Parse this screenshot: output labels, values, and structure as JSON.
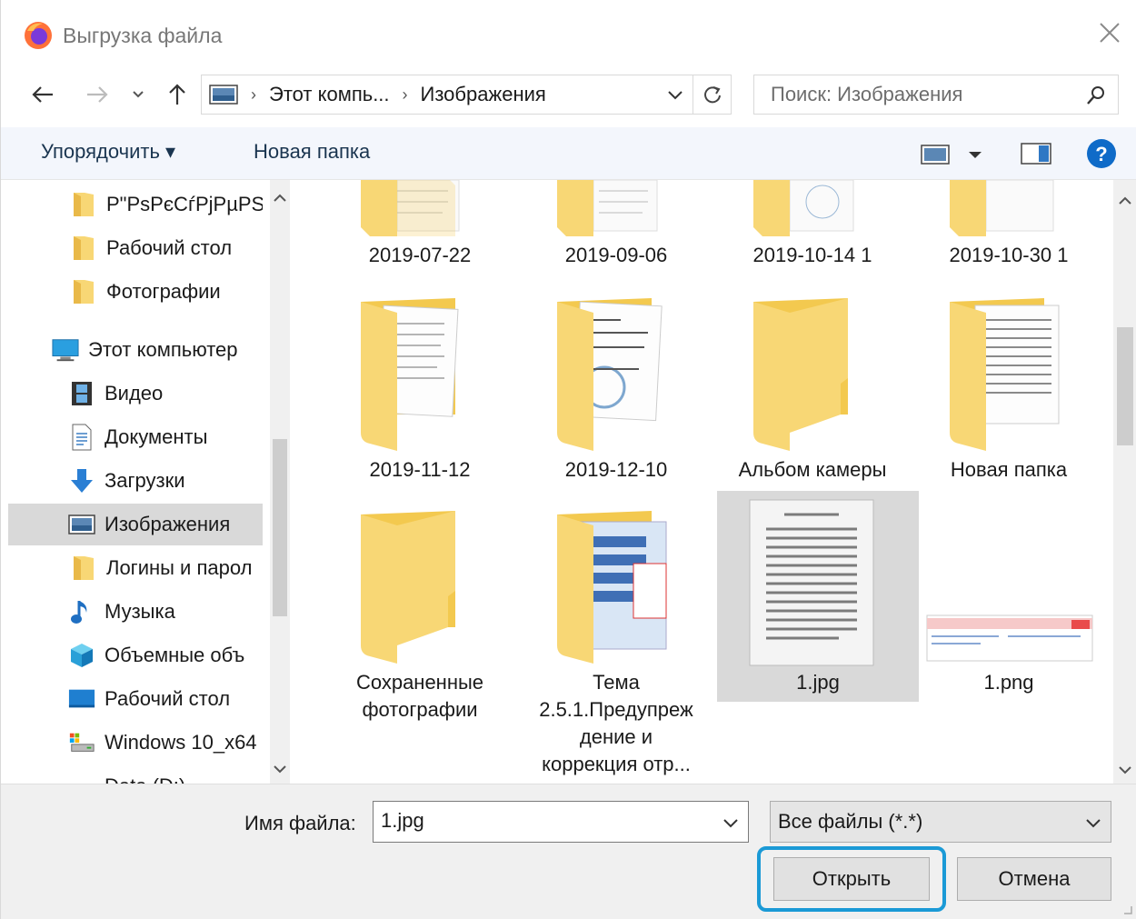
{
  "window": {
    "title": "Выгрузка файла"
  },
  "address": {
    "crumbs": [
      "Этот компь...",
      "Изображения"
    ]
  },
  "search": {
    "placeholder": "Поиск: Изображения"
  },
  "toolbar": {
    "organize_label": "Упорядочить ▾",
    "new_folder_label": "Новая папка"
  },
  "sidebar": {
    "items": [
      {
        "label": "Р\"РѕРєСѓРјРµРЅС",
        "icon": "folder-icon"
      },
      {
        "label": "Рабочий стол",
        "icon": "folder-icon"
      },
      {
        "label": "Фотографии",
        "icon": "folder-icon"
      },
      {
        "label": "Этот компьютер",
        "icon": "computer-icon"
      },
      {
        "label": "Видео",
        "icon": "video-icon"
      },
      {
        "label": "Документы",
        "icon": "documents-icon"
      },
      {
        "label": "Загрузки",
        "icon": "download-icon"
      },
      {
        "label": "Изображения",
        "icon": "pictures-icon"
      },
      {
        "label": "Логины и парол",
        "icon": "folder-icon"
      },
      {
        "label": "Музыка",
        "icon": "music-icon"
      },
      {
        "label": "Объемные объ",
        "icon": "3d-objects-icon"
      },
      {
        "label": "Рабочий стол",
        "icon": "desktop-icon"
      },
      {
        "label": "Windows 10_x64",
        "icon": "drive-icon"
      },
      {
        "label": "Data (D:)",
        "icon": "drive-icon"
      }
    ]
  },
  "files": [
    {
      "label": "2019-07-22",
      "kind": "folder-doc"
    },
    {
      "label": "2019-09-06",
      "kind": "folder-doc"
    },
    {
      "label": "2019-10-14 1",
      "kind": "folder-doc"
    },
    {
      "label": "2019-10-30 1",
      "kind": "folder-doc"
    },
    {
      "label": "2019-11-12",
      "kind": "folder-doc"
    },
    {
      "label": "2019-12-10",
      "kind": "folder-doc"
    },
    {
      "label": "Альбом камеры",
      "kind": "folder"
    },
    {
      "label": "Новая папка",
      "kind": "folder-doc"
    },
    {
      "label": "Сохраненные фотографии",
      "kind": "folder"
    },
    {
      "label": "Тема 2.5.1.Предупреж дение и коррекция отр...",
      "kind": "folder-doc"
    },
    {
      "label": "1.jpg",
      "kind": "image"
    },
    {
      "label": "1.png",
      "kind": "image"
    }
  ],
  "file_lines": {
    "saved_photos": [
      "Сохраненные",
      "фотографии"
    ],
    "tema": [
      "Тема",
      "2.5.1.Предупреж",
      "дение и",
      "коррекция отр..."
    ]
  },
  "bottom": {
    "filename_label": "Имя файла:",
    "filename_value": "1.jpg",
    "filetype_value": "Все файлы (*.*)",
    "open_label": "Открыть",
    "cancel_label": "Отмена"
  },
  "colors": {
    "accent": "#1b9ad6",
    "folder": "#f8d775",
    "help": "#0f6bc8"
  }
}
